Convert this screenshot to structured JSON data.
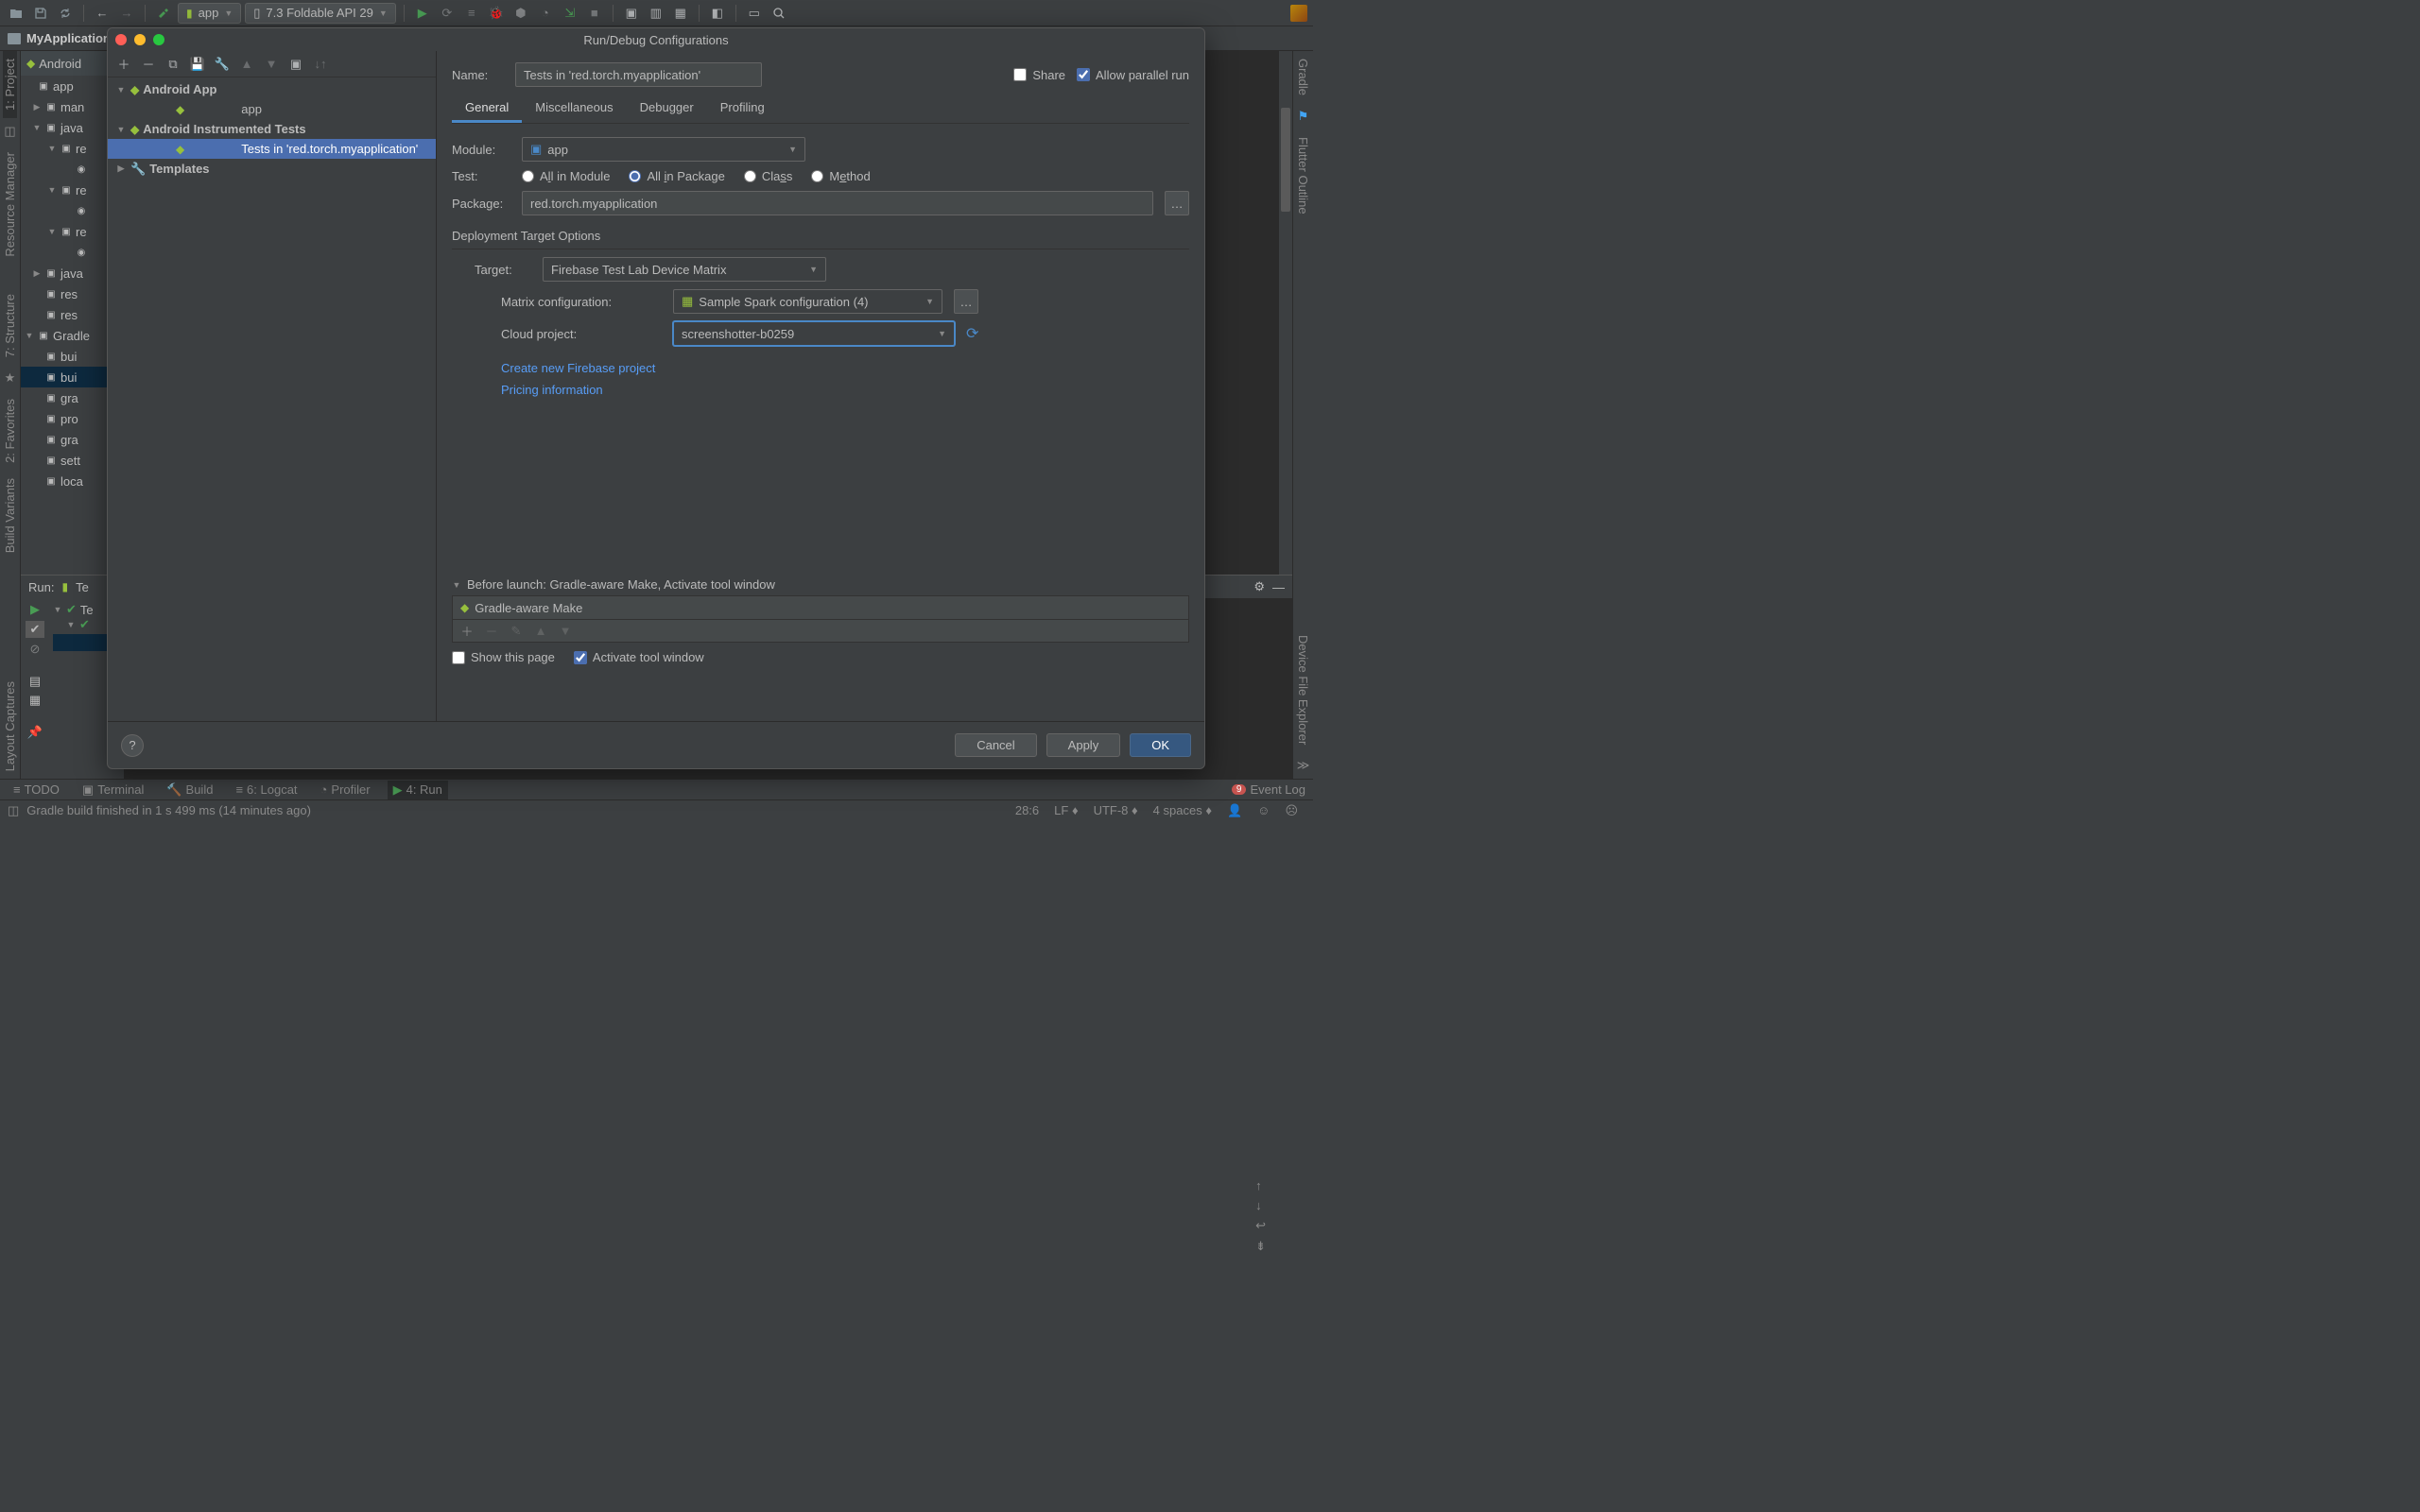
{
  "breadcrumb": {
    "project": "MyApplication"
  },
  "toolbar": {
    "config_selector": "app",
    "device_selector": "7.3  Foldable API 29"
  },
  "project_panel": {
    "header": "Android",
    "tree": [
      {
        "label": "app",
        "lvl": 0,
        "open": true
      },
      {
        "label": "man",
        "lvl": 1,
        "tri": "▶"
      },
      {
        "label": "java",
        "lvl": 1,
        "tri": "▼"
      },
      {
        "label": "re",
        "lvl": 2,
        "tri": "▼"
      },
      {
        "label": "",
        "lvl": 3,
        "icon": "c"
      },
      {
        "label": "re",
        "lvl": 2,
        "tri": "▼"
      },
      {
        "label": "",
        "lvl": 3,
        "icon": "c"
      },
      {
        "label": "re",
        "lvl": 2,
        "tri": "▼"
      },
      {
        "label": "",
        "lvl": 3,
        "icon": "c"
      },
      {
        "label": "java",
        "lvl": 1,
        "tri": "▶"
      },
      {
        "label": "res",
        "lvl": 1
      },
      {
        "label": "res",
        "lvl": 1
      },
      {
        "label": "Gradle",
        "lvl": 0,
        "tri": "▼"
      },
      {
        "label": "bui",
        "lvl": 1
      },
      {
        "label": "bui",
        "lvl": 1,
        "sel": true
      },
      {
        "label": "gra",
        "lvl": 1
      },
      {
        "label": "pro",
        "lvl": 1
      },
      {
        "label": "gra",
        "lvl": 1
      },
      {
        "label": "sett",
        "lvl": 1
      },
      {
        "label": "loca",
        "lvl": 1
      }
    ]
  },
  "left_stripe": [
    "1: Project",
    "Resource Manager",
    "7: Structure",
    "2: Favorites",
    "Build Variants",
    "Layout Captures"
  ],
  "right_stripe": [
    "Gradle",
    "Flutter Outline",
    "Device File Explorer"
  ],
  "run_panel": {
    "label": "Run:",
    "config": "Te",
    "tree_root": "Te"
  },
  "bottom_tabs": {
    "todo": "TODO",
    "terminal": "Terminal",
    "build": "Build",
    "logcat": "6: Logcat",
    "profiler": "Profiler",
    "run": "4: Run",
    "event_log": "Event Log",
    "event_count": "9"
  },
  "status": {
    "msg": "Gradle build finished in 1 s 499 ms (14 minutes ago)",
    "pos": "28:6",
    "le": "LF",
    "enc": "UTF-8",
    "indent": "4 spaces"
  },
  "dialog": {
    "title": "Run/Debug Configurations",
    "name_label": "Name:",
    "name_value": "Tests in 'red.torch.myapplication'",
    "share_label": "Share",
    "parallel_label": "Allow parallel run",
    "tree": [
      {
        "label": "Android App",
        "bold": true,
        "icon": "android",
        "tri": "▼"
      },
      {
        "label": "app",
        "bold": false,
        "icon": "android",
        "indent": 2
      },
      {
        "label": "Android Instrumented Tests",
        "bold": true,
        "icon": "android",
        "tri": "▼"
      },
      {
        "label": "Tests in 'red.torch.myapplication'",
        "bold": false,
        "icon": "android",
        "indent": 2,
        "sel": true
      },
      {
        "label": "Templates",
        "bold": true,
        "icon": "wrench",
        "tri": "▶"
      }
    ],
    "tabs": {
      "general": "General",
      "misc": "Miscellaneous",
      "debugger": "Debugger",
      "profiling": "Profiling"
    },
    "module_label": "Module:",
    "module_value": "app",
    "test_label": "Test:",
    "radios": {
      "all_module": "All in Module",
      "all_package": "All in Package",
      "class": "Class",
      "method": "Method"
    },
    "package_label": "Package:",
    "package_value": "red.torch.myapplication",
    "deploy_title": "Deployment Target Options",
    "target_label": "Target:",
    "target_value": "Firebase Test Lab Device Matrix",
    "matrix_label": "Matrix configuration:",
    "matrix_value": "Sample Spark configuration (4)",
    "cloud_label": "Cloud project:",
    "cloud_value": "screenshotter-b0259",
    "link_create": "Create new Firebase project",
    "link_pricing": "Pricing information",
    "before_launch_title": "Before launch: Gradle-aware Make, Activate tool window",
    "bl_item": "Gradle-aware Make",
    "show_page": "Show this page",
    "activate_tw": "Activate tool window",
    "cancel": "Cancel",
    "apply": "Apply",
    "ok": "OK"
  }
}
